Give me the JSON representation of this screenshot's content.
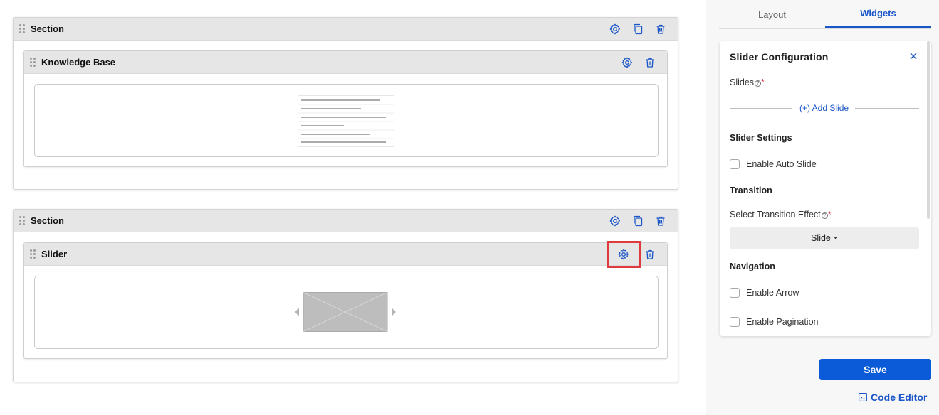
{
  "sections": [
    {
      "title": "Section",
      "widget": {
        "title": "Knowledge Base",
        "type": "knowledge-base"
      }
    },
    {
      "title": "Section",
      "widget": {
        "title": "Slider",
        "type": "slider"
      }
    }
  ],
  "panel": {
    "tabs": [
      {
        "label": "Layout",
        "active": false
      },
      {
        "label": "Widgets",
        "active": true
      }
    ],
    "config": {
      "title": "Slider Configuration",
      "slides_label": "Slides",
      "required_mark": "*",
      "help_glyph": "?",
      "add_slide_label": "(+) Add Slide",
      "slider_settings_heading": "Slider Settings",
      "enable_auto_slide_label": "Enable Auto Slide",
      "transition_heading": "Transition",
      "transition_effect_label": "Select Transition Effect",
      "transition_effect_value": "Slide",
      "navigation_heading": "Navigation",
      "enable_arrow_label": "Enable Arrow",
      "enable_pagination_label": "Enable Pagination",
      "auto_slide_checked": false,
      "arrow_checked": false,
      "pagination_checked": false
    },
    "save_label": "Save",
    "code_editor_label": "Code Editor"
  },
  "colors": {
    "accent": "#1a56c8",
    "save_button": "#0b5bd8",
    "highlight": "#e0393e",
    "header_bg": "#e6e6e6"
  }
}
